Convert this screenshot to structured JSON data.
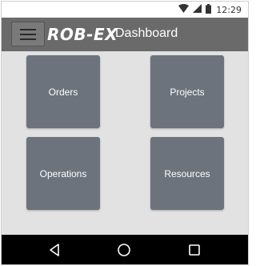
{
  "status_bar": {
    "time": "12:29",
    "icons": [
      "wifi-icon",
      "signal-icon",
      "battery-icon"
    ]
  },
  "app_bar": {
    "menu_icon": "hamburger-menu-icon",
    "logo_text": "ROB-EX",
    "title": "Dashboard",
    "background": "#6a6a6a"
  },
  "tiles": [
    {
      "label": "Orders"
    },
    {
      "label": "Projects"
    },
    {
      "label": "Operations"
    },
    {
      "label": "Resources"
    }
  ],
  "tile_color": "#6c737d",
  "nav_bar": {
    "icons": [
      "back-icon",
      "home-icon",
      "recents-icon"
    ]
  }
}
